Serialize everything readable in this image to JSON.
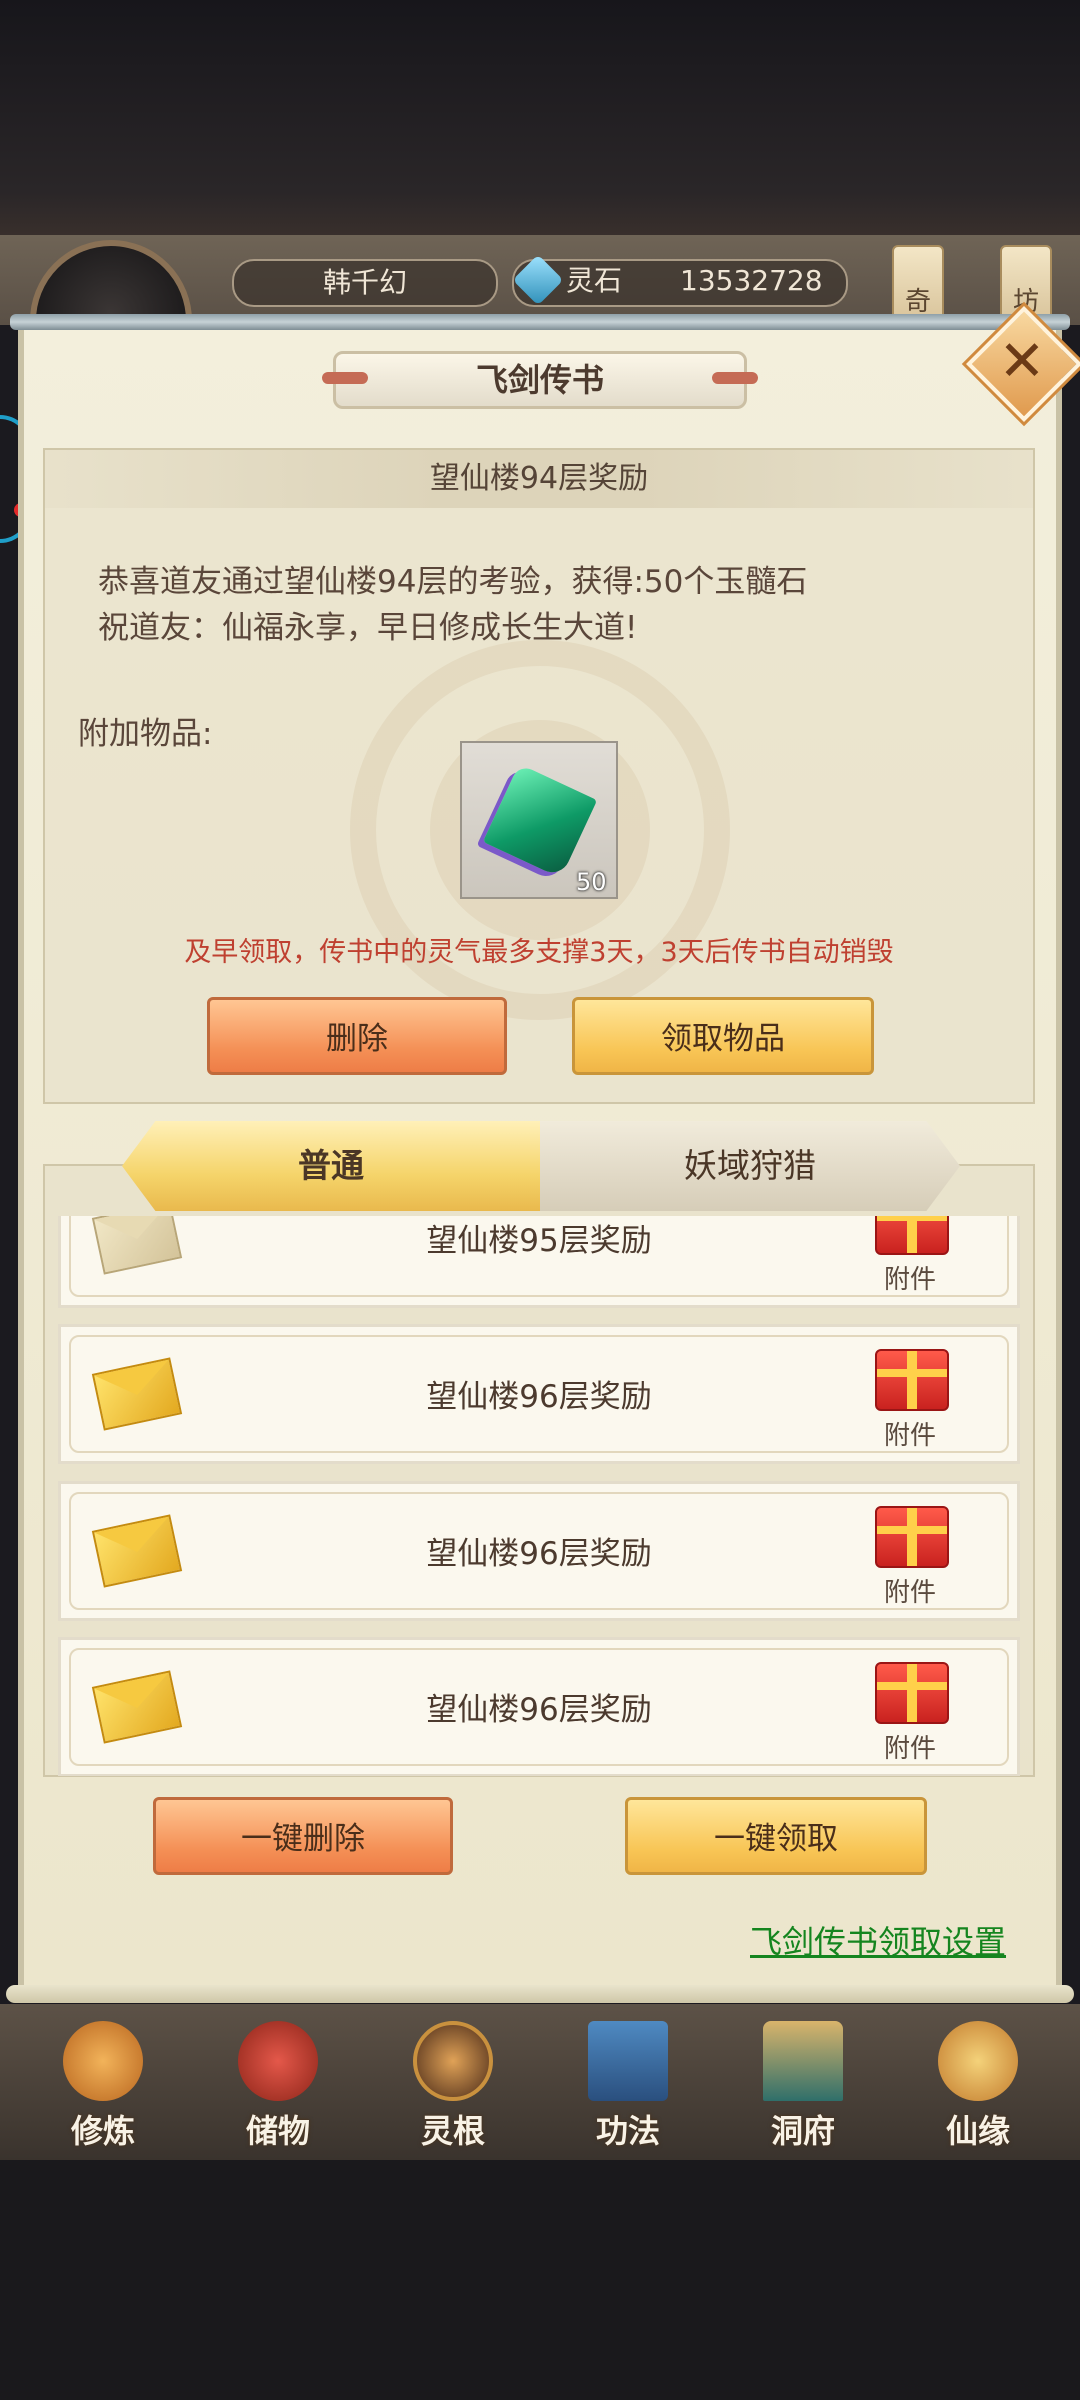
{
  "header": {
    "player_name": "韩千幻",
    "currency_label": "灵石",
    "currency_value": "13532728",
    "side_tabs": [
      "奇",
      "坊"
    ]
  },
  "dialog": {
    "title": "飞剑传书",
    "close_label": "✕",
    "mail": {
      "title": "望仙楼94层奖励",
      "body_lines": [
        "恭喜道友通过望仙楼94层的考验，获得:50个玉髓石",
        "祝道友：仙福永享，早日修成长生大道!"
      ],
      "attachments_label": "附加物品:",
      "attachment": {
        "icon": "jade-stone-icon",
        "count": "50"
      },
      "warning": "及早领取，传书中的灵气最多支撑3天，3天后传书自动销毁",
      "delete_label": "删除",
      "claim_label": "领取物品"
    },
    "tabs": [
      {
        "label": "普通",
        "active": true
      },
      {
        "label": "妖域狩猎",
        "active": false
      }
    ],
    "mail_list": [
      {
        "title": "望仙楼95层奖励",
        "attachment_label": "附件",
        "read": true
      },
      {
        "title": "望仙楼96层奖励",
        "attachment_label": "附件",
        "read": false
      },
      {
        "title": "望仙楼96层奖励",
        "attachment_label": "附件",
        "read": false
      },
      {
        "title": "望仙楼96层奖励",
        "attachment_label": "附件",
        "read": false
      }
    ],
    "delete_all_label": "一键删除",
    "claim_all_label": "一键领取",
    "settings_link": "飞剑传书领取设置"
  },
  "bottom_nav": [
    {
      "label": "修炼",
      "icon": "cultivation-icon"
    },
    {
      "label": "储物",
      "icon": "storage-bag-icon"
    },
    {
      "label": "灵根",
      "icon": "spirit-root-icon"
    },
    {
      "label": "功法",
      "icon": "technique-book-icon"
    },
    {
      "label": "洞府",
      "icon": "cave-dwelling-icon"
    },
    {
      "label": "仙缘",
      "icon": "immortal-fate-icon"
    }
  ],
  "colors": {
    "panel": "#efe9d2",
    "warning": "#bf4030",
    "link": "#15851f",
    "button_red": "#f48f55",
    "button_gold": "#f8c555"
  }
}
